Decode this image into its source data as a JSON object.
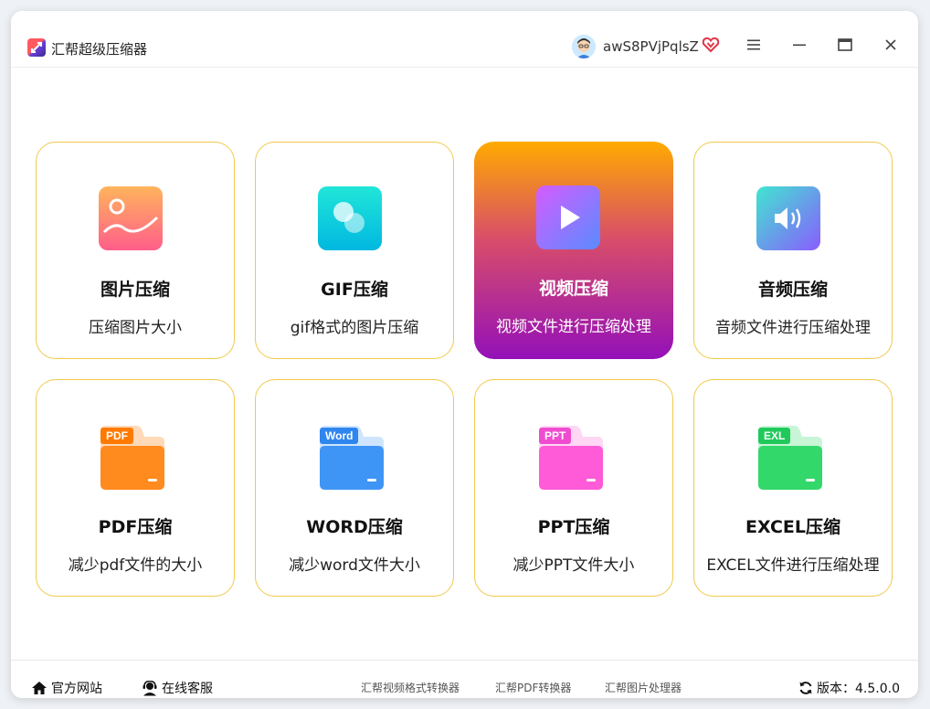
{
  "app": {
    "title": "汇帮超级压缩器"
  },
  "user": {
    "name": "awS8PVjPqlsZ"
  },
  "cards": [
    {
      "title": "图片压缩",
      "desc": "压缩图片大小"
    },
    {
      "title": "GIF压缩",
      "desc": "gif格式的图片压缩"
    },
    {
      "title": "视频压缩",
      "desc": "视频文件进行压缩处理",
      "selected": true
    },
    {
      "title": "音频压缩",
      "desc": "音频文件进行压缩处理"
    },
    {
      "title": "PDF压缩",
      "desc": "减少pdf文件的大小",
      "tag": "PDF"
    },
    {
      "title": "WORD压缩",
      "desc": "减少word文件大小",
      "tag": "Word"
    },
    {
      "title": "PPT压缩",
      "desc": "减少PPT文件大小",
      "tag": "PPT"
    },
    {
      "title": "EXCEL压缩",
      "desc": "EXCEL文件进行压缩处理",
      "tag": "EXL"
    }
  ],
  "footer": {
    "official_site": "官方网站",
    "online_service": "在线客服",
    "links": [
      "汇帮视频格式转换器",
      "汇帮PDF转换器",
      "汇帮图片处理器"
    ],
    "version": "版本：4.5.0.0"
  },
  "colors": {
    "accent_border": "#f1c94c",
    "active_gradient_top": "#ffaa00",
    "active_gradient_bottom": "#9410b8"
  }
}
